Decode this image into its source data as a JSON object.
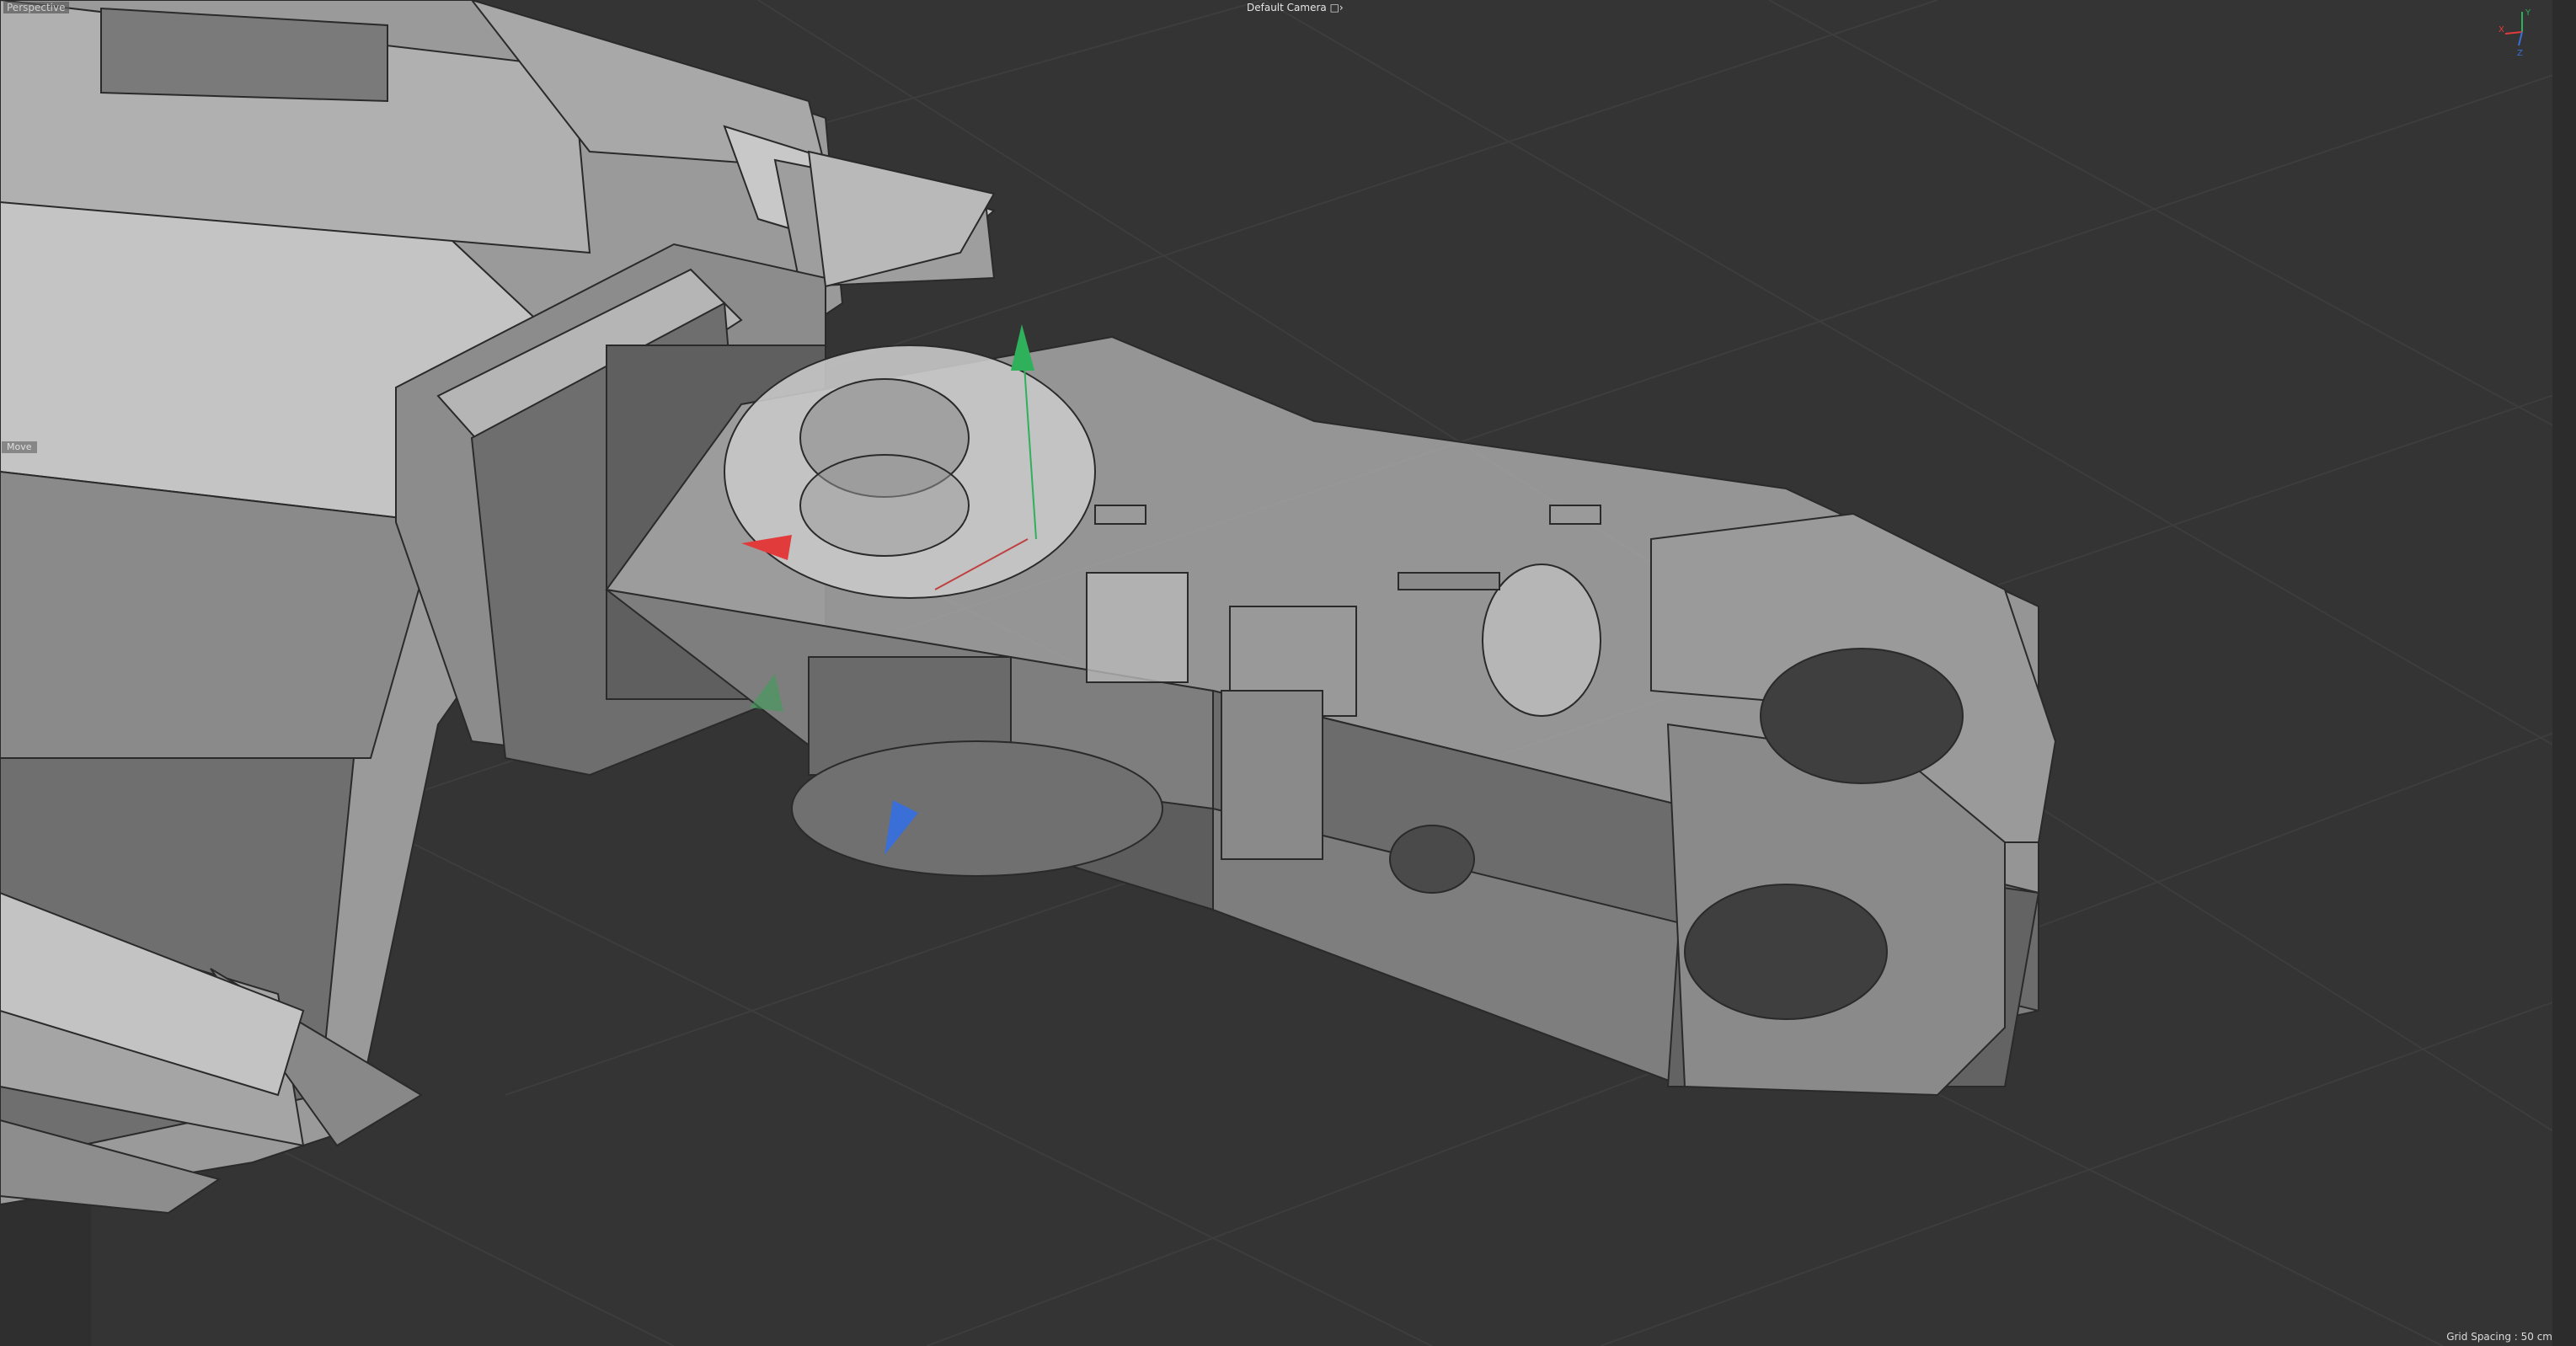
{
  "viewport": {
    "view_name": "Perspective",
    "camera": "Default Camera",
    "camera_icon": "camera-follow-icon",
    "tool": "Move",
    "grid_spacing": "Grid Spacing : 50 cm"
  },
  "axis_gizmo": {
    "x_label": "X",
    "y_label": "Y",
    "z_label": "Z",
    "x_color": "#e23b3b",
    "y_color": "#2fb05a",
    "z_color": "#3a6fd8"
  },
  "colors": {
    "background": "#343434",
    "grid": "#3c3c3c",
    "mesh_light": "#bdbdbd",
    "mesh_dark": "#6a6a6a",
    "wire": "#2a2a2a"
  }
}
